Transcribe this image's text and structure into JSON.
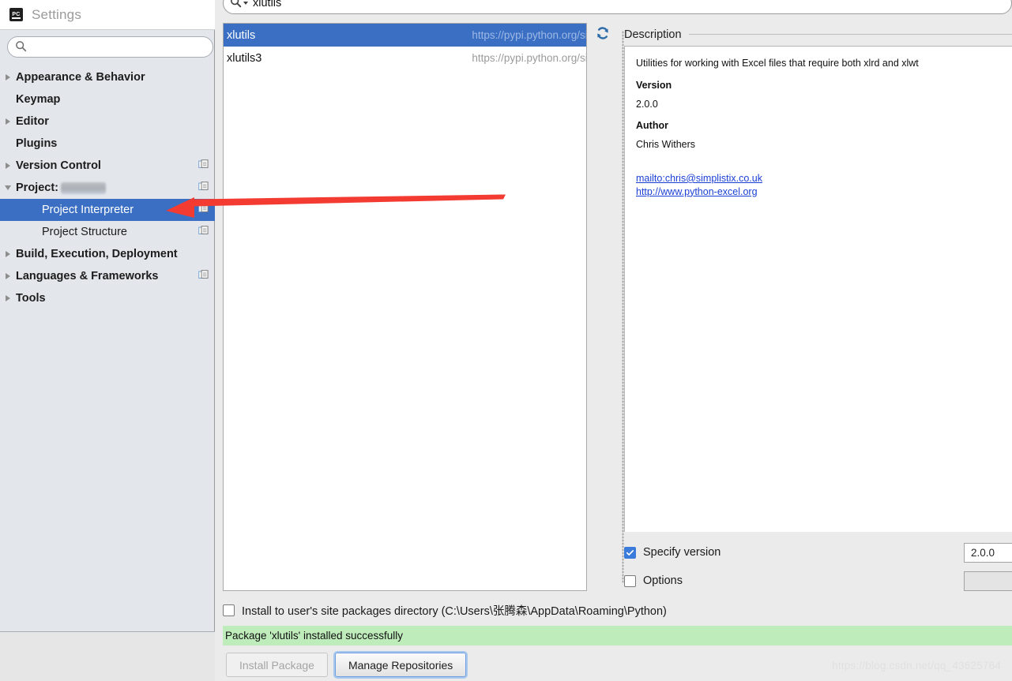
{
  "dialog": {
    "title": "Settings",
    "logo_text": "PC"
  },
  "sidebar": {
    "search": {
      "value": "",
      "placeholder": ""
    },
    "items": [
      {
        "label": "Appearance & Behavior",
        "arrow": "right",
        "level": 0,
        "selected": false,
        "config_icon": false
      },
      {
        "label": "Keymap",
        "arrow": "none",
        "level": 0,
        "selected": false,
        "config_icon": false
      },
      {
        "label": "Editor",
        "arrow": "right",
        "level": 0,
        "selected": false,
        "config_icon": false
      },
      {
        "label": "Plugins",
        "arrow": "none",
        "level": 0,
        "selected": false,
        "config_icon": false
      },
      {
        "label": "Version Control",
        "arrow": "right",
        "level": 0,
        "selected": false,
        "config_icon": true
      },
      {
        "label": "Project:",
        "arrow": "down",
        "level": 0,
        "selected": false,
        "config_icon": true,
        "redacted": true
      },
      {
        "label": "Project Interpreter",
        "arrow": "none",
        "level": 1,
        "selected": true,
        "config_icon": true
      },
      {
        "label": "Project Structure",
        "arrow": "none",
        "level": 1,
        "selected": false,
        "config_icon": true
      },
      {
        "label": "Build, Execution, Deployment",
        "arrow": "right",
        "level": 0,
        "selected": false,
        "config_icon": false
      },
      {
        "label": "Languages & Frameworks",
        "arrow": "right",
        "level": 0,
        "selected": false,
        "config_icon": true
      },
      {
        "label": "Tools",
        "arrow": "right",
        "level": 0,
        "selected": false,
        "config_icon": false
      }
    ]
  },
  "packages": {
    "search": {
      "value": "xlutils",
      "placeholder": ""
    },
    "rows": [
      {
        "name": "xlutils",
        "url": "https://pypi.python.org/simple",
        "selected": true
      },
      {
        "name": "xlutils3",
        "url": "https://pypi.python.org/simple",
        "selected": false
      }
    ]
  },
  "description": {
    "title": "Description",
    "summary": "Utilities for working with Excel files that require both xlrd and xlwt",
    "version_heading": "Version",
    "version_value": "2.0.0",
    "author_heading": "Author",
    "author_value": "Chris Withers",
    "links": [
      "mailto:chris@simplistix.co.uk",
      "http://www.python-excel.org"
    ]
  },
  "options_area": {
    "specify_version_label": "Specify version",
    "specify_version_checked": true,
    "version_value": "2.0.0",
    "options_label": "Options",
    "options_checked": false,
    "options_value": ""
  },
  "bottom": {
    "install_user_label": "Install to user's site packages directory (C:\\Users\\张腾森\\AppData\\Roaming\\Python)",
    "install_user_checked": false,
    "status_message": "Package 'xlutils' installed successfully",
    "install_button": "Install Package",
    "manage_button": "Manage Repositories"
  },
  "watermark": {
    "text": "https://blog.csdn.net/qq_43625764"
  },
  "colors": {
    "selection_blue": "#3a6fc4",
    "sidebar_bg": "#e3e7ec",
    "pane_bg": "#ebebeb",
    "status_green": "#bfecbb",
    "link_blue": "#1a3fd4",
    "arrow_red": "#f43b32"
  }
}
